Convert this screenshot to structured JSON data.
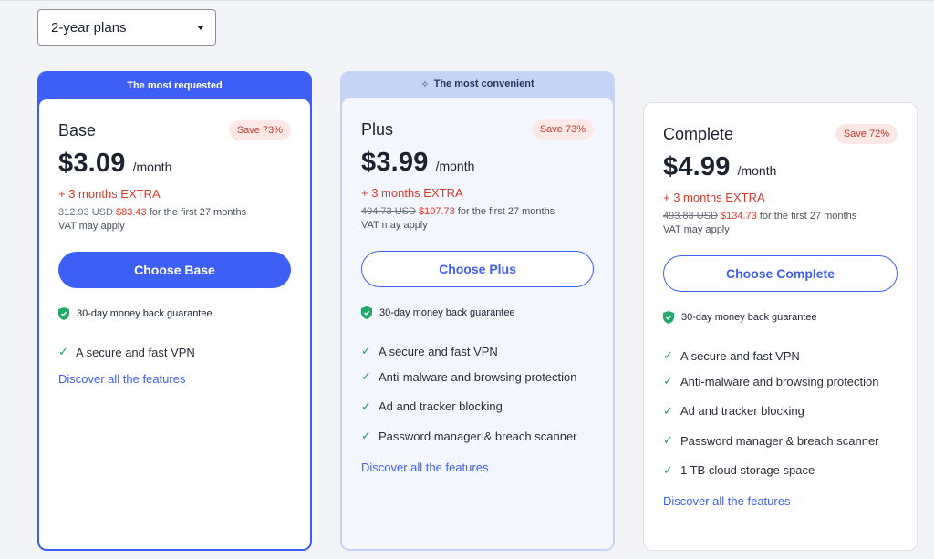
{
  "plan_selector": {
    "selected": "2-year plans"
  },
  "plans": [
    {
      "banner": "The most requested",
      "name": "Base",
      "save": "Save 73%",
      "price": "$3.09",
      "per": "/month",
      "extra": "+ 3 months EXTRA",
      "old_price": "312.93 USD",
      "new_price": "$83.43",
      "term": "for the first 27 months",
      "vat": "VAT may apply",
      "cta": "Choose Base",
      "guarantee": "30-day money back guarantee",
      "features": [
        "A secure and fast VPN"
      ],
      "discover": "Discover all the features"
    },
    {
      "banner": "The most convenient",
      "name": "Plus",
      "save": "Save 73%",
      "price": "$3.99",
      "per": "/month",
      "extra": "+ 3 months EXTRA",
      "old_price": "404.73 USD",
      "new_price": "$107.73",
      "term": "for the first 27 months",
      "vat": "VAT may apply",
      "cta": "Choose Plus",
      "guarantee": "30-day money back guarantee",
      "features": [
        "A secure and fast VPN",
        "Anti-malware and browsing protection",
        "Ad and tracker blocking",
        "Password manager & breach scanner"
      ],
      "discover": "Discover all the features"
    },
    {
      "name": "Complete",
      "save": "Save 72%",
      "price": "$4.99",
      "per": "/month",
      "extra": "+ 3 months EXTRA",
      "old_price": "493.83 USD",
      "new_price": "$134.73",
      "term": "for the first 27 months",
      "vat": "VAT may apply",
      "cta": "Choose Complete",
      "guarantee": "30-day money back guarantee",
      "features": [
        "A secure and fast VPN",
        "Anti-malware and browsing protection",
        "Ad and tracker blocking",
        "Password manager & breach scanner",
        "1 TB cloud storage space"
      ],
      "discover": "Discover all the features"
    }
  ],
  "icons": {
    "guarantee": "shield-check-icon",
    "feature": "check-icon",
    "banner_plus": "sparkle-icon",
    "selector": "caret-down-icon"
  },
  "colors": {
    "accent": "#3e5ff5",
    "extra": "#d93a2b",
    "check": "#1f9d6b",
    "shield": "#22a86b"
  }
}
